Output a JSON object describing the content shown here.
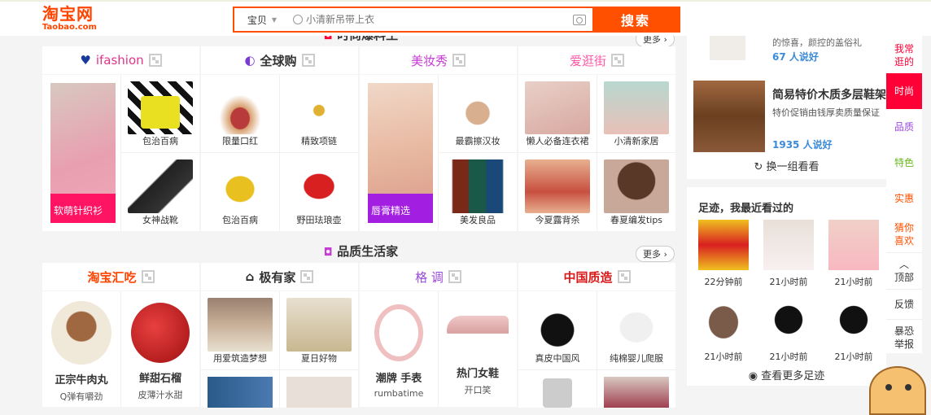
{
  "logo": {
    "cn": "淘宝网",
    "en": "Taobao.com"
  },
  "search": {
    "type": "宝贝",
    "placeholder": "小清新吊带上衣",
    "button": "搜索"
  },
  "section1": {
    "title": "时尚爆料王",
    "more": "更多"
  },
  "section2": {
    "title": "品质生活家",
    "more": "更多"
  },
  "brands1": [
    "ifashion",
    "全球购",
    "美妆秀",
    "爱逛街"
  ],
  "brands2": [
    "淘宝汇吃",
    "极有家",
    "格 调",
    "中国质造"
  ],
  "fashion": {
    "g1": {
      "tall": "软萌针织衫",
      "c": [
        "包治百病",
        "女神战靴"
      ]
    },
    "g2": {
      "c": [
        "限量口红",
        "精致项链",
        "包治百病",
        "野田珐琅壶"
      ]
    },
    "g3": {
      "tall": "唇膏精选",
      "c": [
        "最霸擦汉妆",
        "美发良品"
      ]
    },
    "g4": {
      "c": [
        "懒人必备连衣裙",
        "小清新家居",
        "今夏露背杀",
        "春夏编发tips"
      ]
    }
  },
  "quality": {
    "g1": {
      "c": [
        {
          "t": "正宗牛肉丸",
          "s": "Q弹有嚼劲"
        },
        {
          "t": "鲜甜石榴",
          "s": "皮薄汁水甜"
        }
      ]
    },
    "g2": {
      "c": [
        "用爱筑造梦想",
        "夏日好物"
      ]
    },
    "g3": {
      "c": [
        {
          "t": "潮牌 手表",
          "s": "rumbatime"
        },
        {
          "t": "热门女鞋",
          "s": "开口笑"
        }
      ]
    },
    "g4": {
      "c": [
        "真皮中国风",
        "纯棉婴儿爬服"
      ]
    }
  },
  "recommend": {
    "item1": {
      "title": "的惊喜，颜控的盖俗礼",
      "likes": "67 人说好"
    },
    "item2": {
      "title": "简易特价木质多层鞋架",
      "desc": "特价促销由钱厚卖质量保证",
      "likes": "1935 人说好"
    },
    "refresh": "换一组看看"
  },
  "footprint": {
    "title": "足迹，我最近看过的",
    "times": [
      "22分钟前",
      "21小时前",
      "21小时前",
      "21小时前",
      "21小时前",
      "21小时前"
    ],
    "more": "查看更多足迹"
  },
  "sticky": [
    "我常逛的",
    "时尚",
    "品质",
    "特色",
    "实惠",
    "猜你喜欢",
    "顶部",
    "反馈",
    "暴恐举报"
  ],
  "colors": {
    "brand": "#ff5000",
    "active": "#ff0036"
  }
}
